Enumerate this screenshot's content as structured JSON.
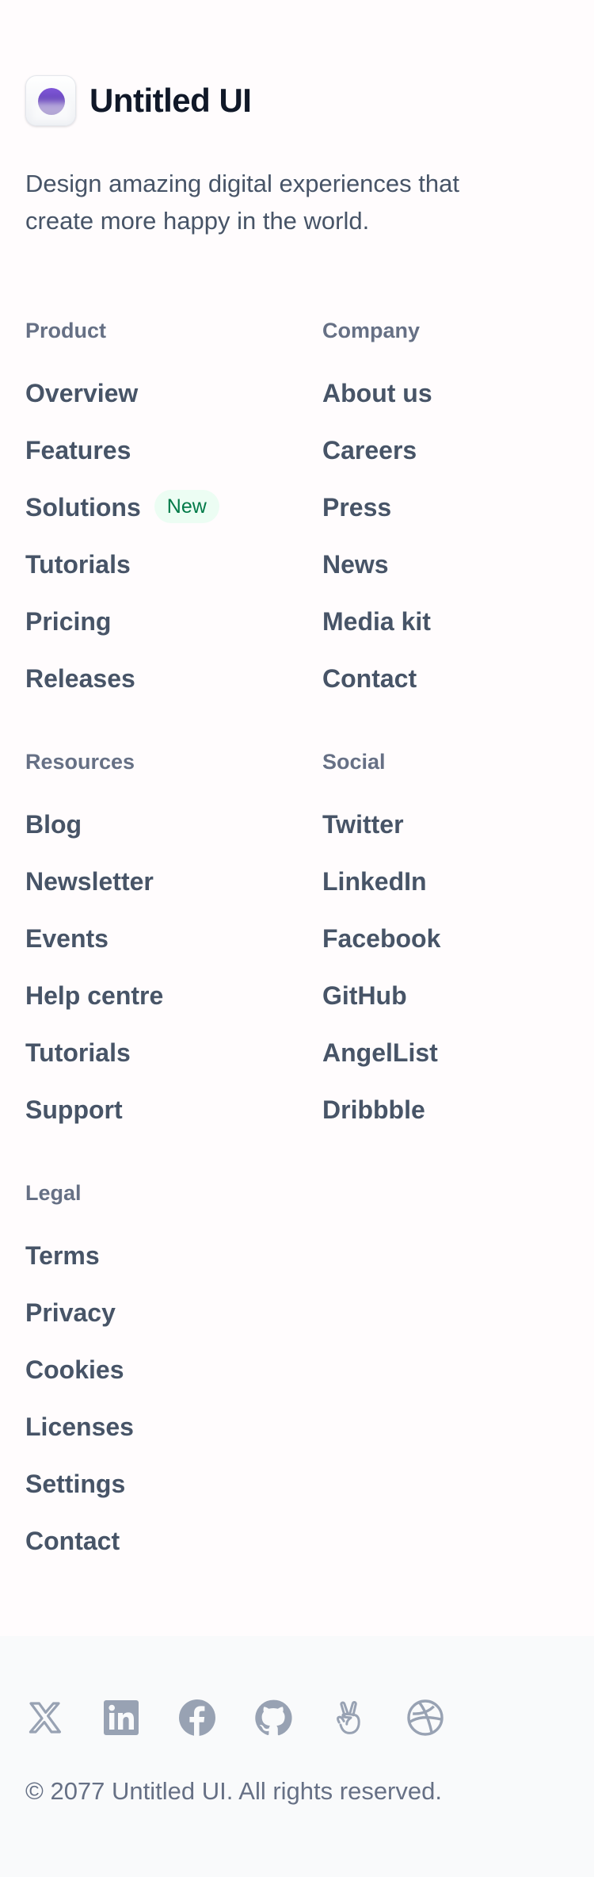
{
  "brand": {
    "name": "Untitled UI",
    "logo_icon": "logo-orb-icon",
    "accent": "#7f56d9"
  },
  "tagline": "Design amazing digital experiences that create more happy in the world.",
  "columns": [
    {
      "heading": "Product",
      "links": [
        "Overview",
        "Features",
        "Solutions",
        "Tutorials",
        "Pricing",
        "Releases"
      ],
      "badge": {
        "after": "Solutions",
        "label": "New"
      }
    },
    {
      "heading": "Company",
      "links": [
        "About us",
        "Careers",
        "Press",
        "News",
        "Media kit",
        "Contact"
      ]
    },
    {
      "heading": "Resources",
      "links": [
        "Blog",
        "Newsletter",
        "Events",
        "Help centre",
        "Tutorials",
        "Support"
      ]
    },
    {
      "heading": "Social",
      "links": [
        "Twitter",
        "LinkedIn",
        "Facebook",
        "GitHub",
        "AngelList",
        "Dribbble"
      ]
    },
    {
      "heading": "Legal",
      "links": [
        "Terms",
        "Privacy",
        "Cookies",
        "Licenses",
        "Settings",
        "Contact"
      ]
    }
  ],
  "social_icons": [
    "x-icon",
    "linkedin-icon",
    "facebook-icon",
    "github-icon",
    "angellist-icon",
    "dribbble-icon"
  ],
  "copyright": "© 2077 Untitled UI. All rights reserved.",
  "colors": {
    "link": "#475467",
    "heading": "#667085",
    "badge_bg": "#ecfdf3",
    "badge_text": "#027a48",
    "footer_bg": "#f9fafb",
    "icon": "#98a2b3"
  }
}
